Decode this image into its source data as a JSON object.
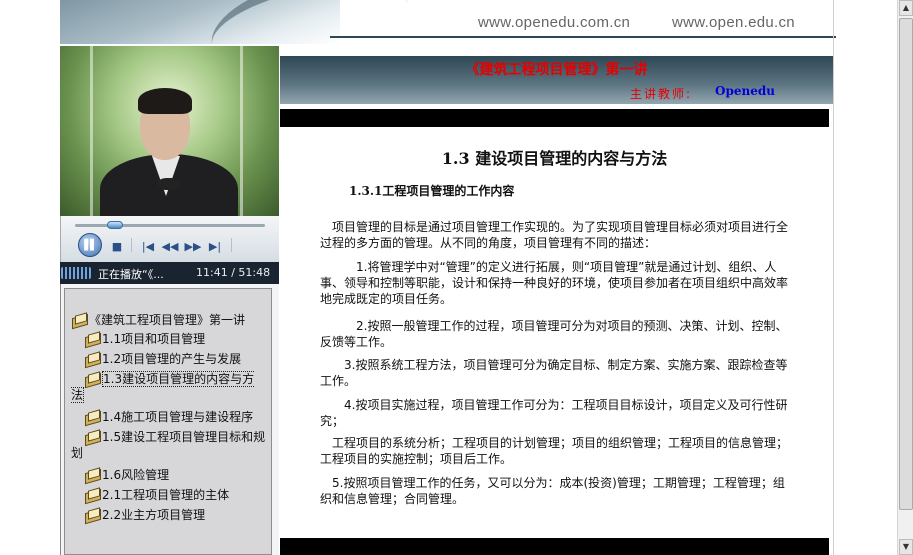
{
  "header": {
    "url_1": "www.openedu.com.cn",
    "url_2": "www.open.edu.cn"
  },
  "player": {
    "pause_icon": "pause-icon",
    "status_label": "正在播放“《...",
    "current_time": "11:41",
    "time_separator": "/",
    "total_time": "51:48",
    "progress_fraction": 0.21
  },
  "toc": {
    "root": "《建筑工程项目管理》第一讲",
    "items": [
      {
        "label": "1.1项目和项目管理"
      },
      {
        "label": "1.2项目管理的产生与发展"
      },
      {
        "label": "1.3建设项目管理的内容与方法",
        "selected": true
      },
      {
        "label": "1.4施工项目管理与建设程序"
      },
      {
        "label": "1.5建设工程项目管理目标和规划"
      },
      {
        "label": "1.6风险管理"
      },
      {
        "label": "2.1工程项目管理的主体"
      },
      {
        "label": "2.2业主方项目管理"
      }
    ]
  },
  "course": {
    "title": "《建筑工程项目管理》第一讲",
    "teacher_label": "主讲教师:",
    "teacher_name": "Openedu"
  },
  "content": {
    "section_title": "1.3 建设项目管理的内容与方法",
    "subsection_title": "1.3.1工程项目管理的工作内容",
    "paragraphs": [
      "项目管理的目标是通过项目管理工作实现的。为了实现项目管理目标必须对项目进行全过程的多方面的管理。从不同的角度，项目管理有不同的描述：",
      "1.将管理学中对“管理”的定义进行拓展，则“项目管理”就是通过计划、组织、人事、领导和控制等职能，设计和保持一种良好的环境，使项目参加者在项目组织中高效率地完成既定的项目任务。",
      "2.按照一般管理工作的过程，项目管理可分为对项目的预测、决策、计划、控制、反馈等工作。",
      "3.按照系统工程方法，项目管理可分为确定目标、制定方案、实施方案、跟踪检查等工作。",
      "4.按项目实施过程，项目管理工作可分为：工程项目目标设计，项目定义及可行性研究；",
      "工程项目的系统分析；工程项目的计划管理；项目的组织管理；工程项目的信息管理；工程项目的实施控制；项目后工作。",
      "5.按照项目管理工作的任务，又可以分为：成本(投资)管理；工期管理；工程管理；组织和信息管理；合同管理。"
    ]
  }
}
